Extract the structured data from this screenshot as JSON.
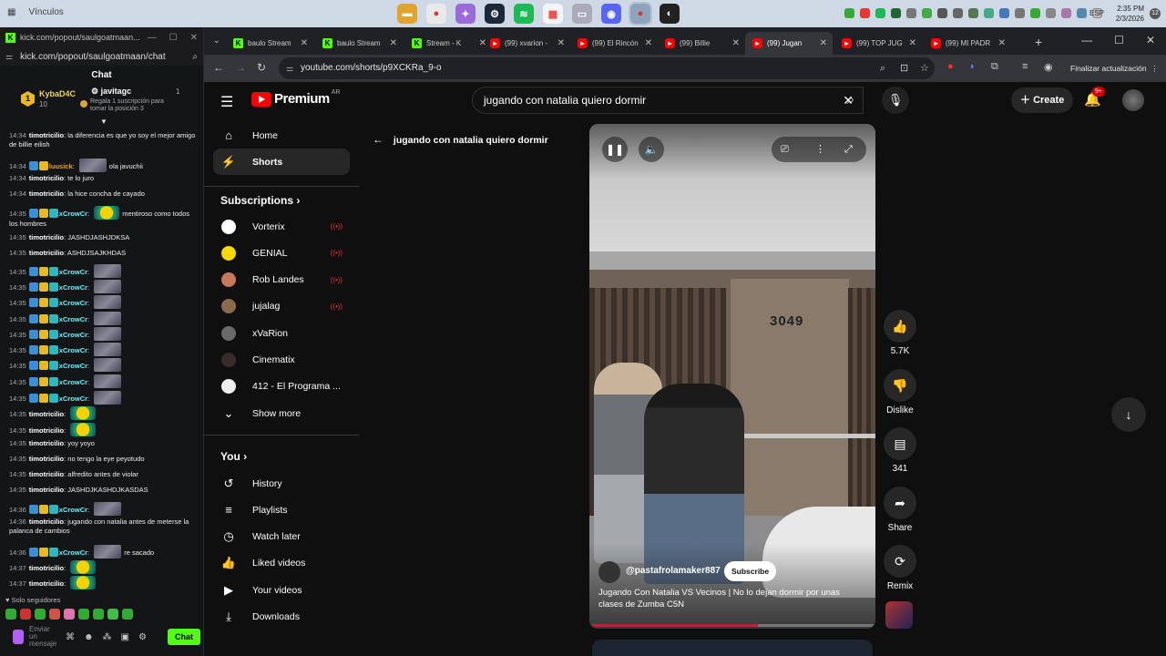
{
  "taskbar": {
    "left_label": "Vínculos",
    "lang": "ESP",
    "time": "2:35 PM",
    "date": "2/3/2026",
    "notif_count": "12"
  },
  "kick": {
    "window_title": "kick.com/popout/saulgoatmaan...",
    "url": "kick.com/popout/saulgoatmaan/chat",
    "chat_title": "Chat",
    "pinned": {
      "rank": "1",
      "user1": "KybaD4C",
      "user1_count": "10",
      "user2": "javitagc",
      "user2_count": "1",
      "hint": "Regala 1 suscripción para tomar la posición 3"
    },
    "messages": [
      {
        "time": "14:34",
        "user": "timotricilio",
        "color": "white",
        "text": "la diferencia es que yo soy el mejor amigo de billie eilish",
        "badges": 0,
        "emote": ""
      },
      {
        "time": "14:34",
        "user": "luusick",
        "color": "orange",
        "text": "ola javuchii",
        "badges": 2,
        "emote": "img"
      },
      {
        "time": "14:34",
        "user": "timotricilio",
        "color": "white",
        "text": "te lo juro",
        "badges": 0,
        "emote": ""
      },
      {
        "time": "14:34",
        "user": "timotricilio",
        "color": "white",
        "text": "la hice concha de cayado",
        "badges": 0,
        "emote": ""
      },
      {
        "time": "14:35",
        "user": "xCrowCr",
        "color": "cyan",
        "text": "mentiroso como todos los hombres",
        "badges": 3,
        "emote": "yellow"
      },
      {
        "time": "14:35",
        "user": "timotricilio",
        "color": "white",
        "text": "JASHDJASHJDKSA",
        "badges": 0,
        "emote": ""
      },
      {
        "time": "14:35",
        "user": "timotricilio",
        "color": "white",
        "text": "ASHDJSAJKHDAS",
        "badges": 0,
        "emote": ""
      },
      {
        "time": "14:35",
        "user": "xCrowCr",
        "color": "cyan",
        "text": "",
        "badges": 3,
        "emote": "img"
      },
      {
        "time": "14:35",
        "user": "xCrowCr",
        "color": "cyan",
        "text": "",
        "badges": 3,
        "emote": "img"
      },
      {
        "time": "14:35",
        "user": "xCrowCr",
        "color": "cyan",
        "text": "",
        "badges": 3,
        "emote": "img"
      },
      {
        "time": "14:35",
        "user": "xCrowCr",
        "color": "cyan",
        "text": "",
        "badges": 3,
        "emote": "img"
      },
      {
        "time": "14:35",
        "user": "xCrowCr",
        "color": "cyan",
        "text": "",
        "badges": 3,
        "emote": "img"
      },
      {
        "time": "14:35",
        "user": "xCrowCr",
        "color": "cyan",
        "text": "",
        "badges": 3,
        "emote": "img"
      },
      {
        "time": "14:35",
        "user": "xCrowCr",
        "color": "cyan",
        "text": "",
        "badges": 3,
        "emote": "img"
      },
      {
        "time": "14:35",
        "user": "xCrowCr",
        "color": "cyan",
        "text": "",
        "badges": 3,
        "emote": "img"
      },
      {
        "time": "14:35",
        "user": "xCrowCr",
        "color": "cyan",
        "text": "",
        "badges": 3,
        "emote": "img"
      },
      {
        "time": "14:35",
        "user": "timotricilio",
        "color": "white",
        "text": "",
        "badges": 0,
        "emote": "yellow"
      },
      {
        "time": "14:35",
        "user": "timotricilio",
        "color": "white",
        "text": "",
        "badges": 0,
        "emote": "yellow"
      },
      {
        "time": "14:35",
        "user": "timotricilio",
        "color": "white",
        "text": "yoy yoyo",
        "badges": 0,
        "emote": ""
      },
      {
        "time": "14:35",
        "user": "timotricilio",
        "color": "white",
        "text": "no tengo la eye peyotudo",
        "badges": 0,
        "emote": ""
      },
      {
        "time": "14:35",
        "user": "timotricilio",
        "color": "white",
        "text": "alfredito antes de violar",
        "badges": 0,
        "emote": ""
      },
      {
        "time": "14:35",
        "user": "timotricilio",
        "color": "white",
        "text": "JASHDJKASHDJKASDAS",
        "badges": 0,
        "emote": ""
      },
      {
        "time": "14:36",
        "user": "xCrowCr",
        "color": "cyan",
        "text": "",
        "badges": 3,
        "emote": "img"
      },
      {
        "time": "14:36",
        "user": "timotricilio",
        "color": "white",
        "text": "jugando con natalia antes de meterse la palanca de cambios",
        "badges": 0,
        "emote": ""
      },
      {
        "time": "14:36",
        "user": "xCrowCr",
        "color": "cyan",
        "text": "re sacado",
        "badges": 3,
        "emote": "img"
      },
      {
        "time": "14:37",
        "user": "timotricilio",
        "color": "white",
        "text": "",
        "badges": 0,
        "emote": "yellow"
      },
      {
        "time": "14:37",
        "user": "timotricilio",
        "color": "white",
        "text": "",
        "badges": 0,
        "emote": "yellow"
      }
    ],
    "followers_only": "Solo seguidores",
    "send_placeholder": "Enviar un mensaje",
    "chat_button": "Chat"
  },
  "chrome": {
    "tabs": [
      {
        "label": "baulo Stream",
        "fav": "k",
        "active": false
      },
      {
        "label": "baulo Stream",
        "fav": "k",
        "active": false
      },
      {
        "label": "Stream - K",
        "fav": "k",
        "active": false
      },
      {
        "label": "(99) xvarion -",
        "fav": "y",
        "active": false
      },
      {
        "label": "(99) El Rincón",
        "fav": "y",
        "active": false
      },
      {
        "label": "(99) Billie",
        "fav": "y",
        "active": false
      },
      {
        "label": "(99) Jugan",
        "fav": "y",
        "active": true
      },
      {
        "label": "(99) TOP JUG",
        "fav": "y",
        "active": false
      },
      {
        "label": "(99) MI PADR",
        "fav": "y",
        "active": false
      }
    ],
    "url": "youtube.com/shorts/p9XCKRa_9-o",
    "update_label": "Finalizar actualización"
  },
  "youtube": {
    "logo_text": "Premium",
    "country": "AR",
    "search_value": "jugando con natalia quiero dormir",
    "create_label": "Create",
    "notif_badge": "9+",
    "nav": [
      {
        "label": "Home",
        "icon": "home-icon",
        "active": false
      },
      {
        "label": "Shorts",
        "icon": "shorts-icon",
        "active": true
      }
    ],
    "subscriptions_heading": "Subscriptions",
    "subscriptions": [
      {
        "label": "Vorterix",
        "live": true,
        "color": "#ffffff"
      },
      {
        "label": "GENIAL",
        "live": true,
        "color": "#f5d800"
      },
      {
        "label": "Rob Landes",
        "live": true,
        "color": "#c9775a"
      },
      {
        "label": "jujalag",
        "live": true,
        "color": "#8a6a4a"
      },
      {
        "label": "xVaRion",
        "live": false,
        "color": "#6a6a6a"
      },
      {
        "label": "Cinematix",
        "live": false,
        "color": "#3a2a2a"
      },
      {
        "label": "412 - El Programa ...",
        "live": false,
        "color": "#eeeeee"
      }
    ],
    "show_more": "Show more",
    "you_heading": "You",
    "you_items": [
      {
        "label": "History",
        "icon": "history-icon"
      },
      {
        "label": "Playlists",
        "icon": "playlists-icon"
      },
      {
        "label": "Watch later",
        "icon": "watch-later-icon"
      },
      {
        "label": "Liked videos",
        "icon": "liked-videos-icon"
      },
      {
        "label": "Your videos",
        "icon": "your-videos-icon"
      },
      {
        "label": "Downloads",
        "icon": "downloads-icon"
      }
    ],
    "short_title": "jugando con natalia quiero dormir",
    "video": {
      "building_number": "3049",
      "channel": "@pastafrolamaker887",
      "subscribe_label": "Subscribe",
      "description": "Jugando Con Natalia VS Vecinos | No lo dejan dormir por unas clases de Zumba C5N",
      "progress": 0.59
    },
    "actions": {
      "likes": "5.7K",
      "dislike_label": "Dislike",
      "comments": "341",
      "share_label": "Share",
      "remix_label": "Remix"
    }
  }
}
